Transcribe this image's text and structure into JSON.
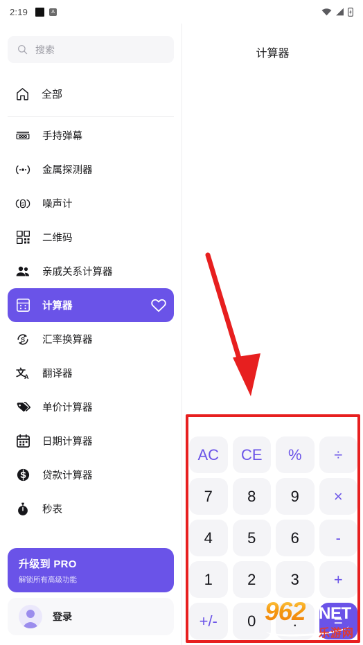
{
  "statusbar": {
    "time": "2:19",
    "left_icons": [
      "black-square-icon",
      "app-badge-icon"
    ],
    "badge_text": "A",
    "right_icons": [
      "wifi-icon",
      "signal-icon",
      "battery-icon"
    ]
  },
  "sidebar": {
    "search": {
      "placeholder": "搜索",
      "value": "",
      "icon": "search-icon"
    },
    "all": {
      "label": "全部",
      "icon": "home-icon"
    },
    "items": [
      {
        "label": "手持弹幕",
        "icon": "danmaku-icon",
        "active": false
      },
      {
        "label": "金属探测器",
        "icon": "metal-detector-icon",
        "active": false
      },
      {
        "label": "噪声计",
        "icon": "noise-meter-icon",
        "active": false
      },
      {
        "label": "二维码",
        "icon": "qrcode-icon",
        "active": false
      },
      {
        "label": "亲戚关系计算器",
        "icon": "people-icon",
        "active": false
      },
      {
        "label": "计算器",
        "icon": "calculator-icon",
        "active": true,
        "favorite_icon": "heart-icon"
      },
      {
        "label": "汇率换算器",
        "icon": "currency-exchange-icon",
        "active": false
      },
      {
        "label": "翻译器",
        "icon": "translate-icon",
        "active": false
      },
      {
        "label": "单价计算器",
        "icon": "price-tag-icon",
        "active": false
      },
      {
        "label": "日期计算器",
        "icon": "calendar-icon",
        "active": false
      },
      {
        "label": "贷款计算器",
        "icon": "dollar-circle-icon",
        "active": false
      },
      {
        "label": "秒表",
        "icon": "stopwatch-icon",
        "active": false
      }
    ],
    "pro_card": {
      "title": "升级到 PRO",
      "subtitle": "解锁所有高级功能"
    },
    "login": {
      "label": "登录",
      "icon": "avatar-icon"
    }
  },
  "content": {
    "title": "计算器",
    "keypad": [
      {
        "label": "AC",
        "type": "op"
      },
      {
        "label": "CE",
        "type": "op"
      },
      {
        "label": "%",
        "type": "op"
      },
      {
        "label": "÷",
        "type": "op"
      },
      {
        "label": "7",
        "type": "num"
      },
      {
        "label": "8",
        "type": "num"
      },
      {
        "label": "9",
        "type": "num"
      },
      {
        "label": "×",
        "type": "op"
      },
      {
        "label": "4",
        "type": "num"
      },
      {
        "label": "5",
        "type": "num"
      },
      {
        "label": "6",
        "type": "num"
      },
      {
        "label": "-",
        "type": "op"
      },
      {
        "label": "1",
        "type": "num"
      },
      {
        "label": "2",
        "type": "num"
      },
      {
        "label": "3",
        "type": "num"
      },
      {
        "label": "+",
        "type": "op"
      },
      {
        "label": "+/-",
        "type": "op"
      },
      {
        "label": "0",
        "type": "num"
      },
      {
        "label": ".",
        "type": "num"
      },
      {
        "label": "=",
        "type": "eq"
      }
    ]
  },
  "annotations": {
    "highlight_rect_color": "#e71f1f",
    "arrow_color": "#e71f1f"
  },
  "watermark": {
    "number": "962",
    "domain": ".NET",
    "chinese": "乐游网"
  },
  "colors": {
    "accent_purple": "#6a53e8",
    "key_bg": "#f4f4f7",
    "annotation_red": "#e71f1f"
  }
}
